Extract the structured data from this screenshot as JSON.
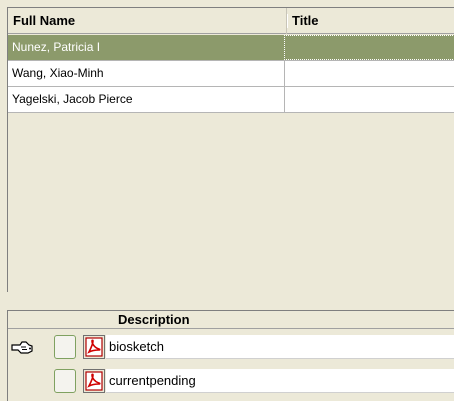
{
  "people_grid": {
    "columns": {
      "full_name": "Full Name",
      "title": "Title"
    },
    "rows": [
      {
        "full_name": "Nunez, Patricia I",
        "title": ""
      },
      {
        "full_name": "Wang, Xiao-Minh",
        "title": ""
      },
      {
        "full_name": "Yagelski, Jacob Pierce",
        "title": ""
      }
    ],
    "selected_row_color": "#8c9a6b"
  },
  "docs_panel": {
    "columns": {
      "description": "Description"
    },
    "rows": [
      {
        "description": "biosketch",
        "icon": "pdf-icon",
        "current": true
      },
      {
        "description": "currentpending",
        "icon": "pdf-icon",
        "current": false
      }
    ]
  }
}
